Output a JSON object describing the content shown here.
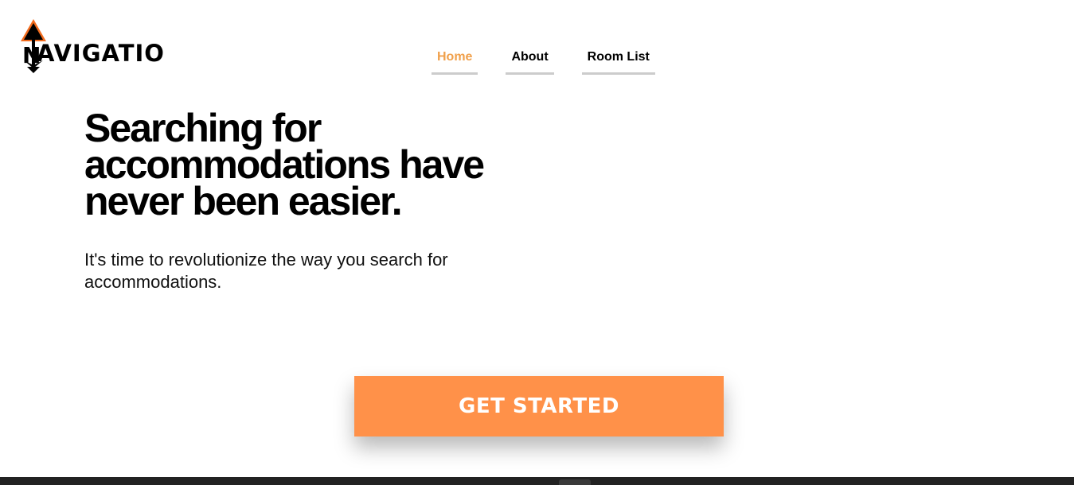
{
  "brand": {
    "logo_text": "AVIGATIO",
    "logo_icon": "compass-arrow-icon",
    "accent_color": "#f26b1d"
  },
  "nav": {
    "items": [
      {
        "label": "Home",
        "active": true
      },
      {
        "label": "About",
        "active": false
      },
      {
        "label": "Room List",
        "active": false
      }
    ],
    "active_color": "#f0a04b"
  },
  "hero": {
    "title": "Searching for accommodations have never been easier.",
    "subtitle": "It's time to revolutionize the way you search for accommodations."
  },
  "cta": {
    "label": "GET STARTED",
    "color": "#ff9149"
  }
}
